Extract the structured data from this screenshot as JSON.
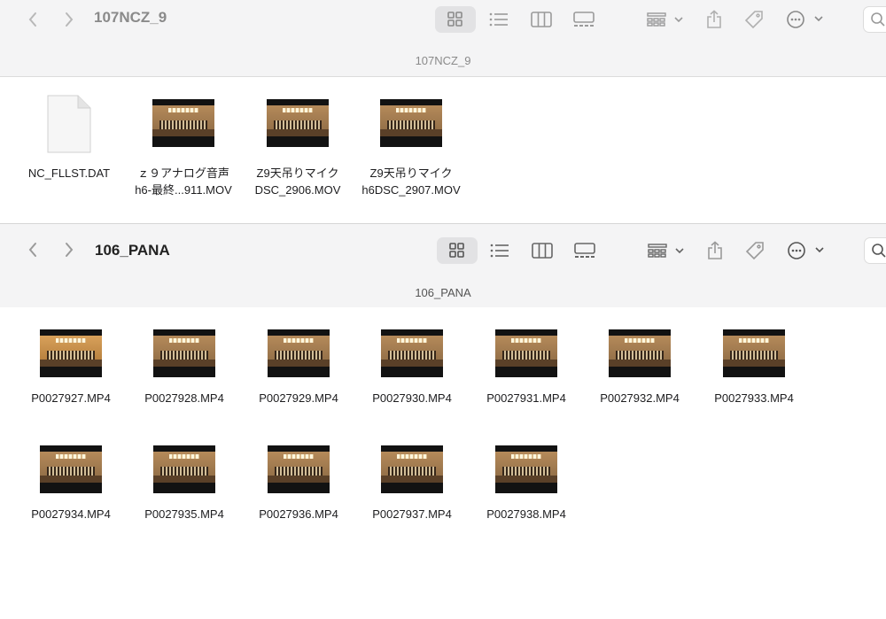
{
  "window_top": {
    "title": "107NCZ_9",
    "path": "107NCZ_9",
    "items": [
      {
        "kind": "document",
        "name": "NC_FLLST.DAT"
      },
      {
        "kind": "video",
        "name": "ｚ９アナログ音声\nh6-最終...911.MOV"
      },
      {
        "kind": "video",
        "name": "Z9天吊りマイク\nDSC_2906.MOV"
      },
      {
        "kind": "video",
        "name": "Z9天吊りマイク\nh6DSC_2907.MOV"
      }
    ]
  },
  "window_bottom": {
    "title": "106_PANA",
    "path": "106_PANA",
    "items": [
      {
        "name": "P0027927.MP4"
      },
      {
        "name": "P0027928.MP4"
      },
      {
        "name": "P0027929.MP4"
      },
      {
        "name": "P0027930.MP4"
      },
      {
        "name": "P0027931.MP4"
      },
      {
        "name": "P0027932.MP4"
      },
      {
        "name": "P0027933.MP4"
      },
      {
        "name": "P0027934.MP4"
      },
      {
        "name": "P0027935.MP4"
      },
      {
        "name": "P0027936.MP4"
      },
      {
        "name": "P0027937.MP4"
      },
      {
        "name": "P0027938.MP4"
      }
    ]
  },
  "toolbar_icons": [
    "back-icon",
    "forward-icon",
    "icon-view-icon",
    "list-view-icon",
    "column-view-icon",
    "gallery-view-icon",
    "group-icon",
    "share-icon",
    "tag-icon",
    "more-icon",
    "search-icon"
  ],
  "colors": {
    "toolbar": "#f4f4f5",
    "selected_button": "#e2e2e4",
    "icon": "#7a7a7a",
    "path_text": "#8a8a8a"
  }
}
